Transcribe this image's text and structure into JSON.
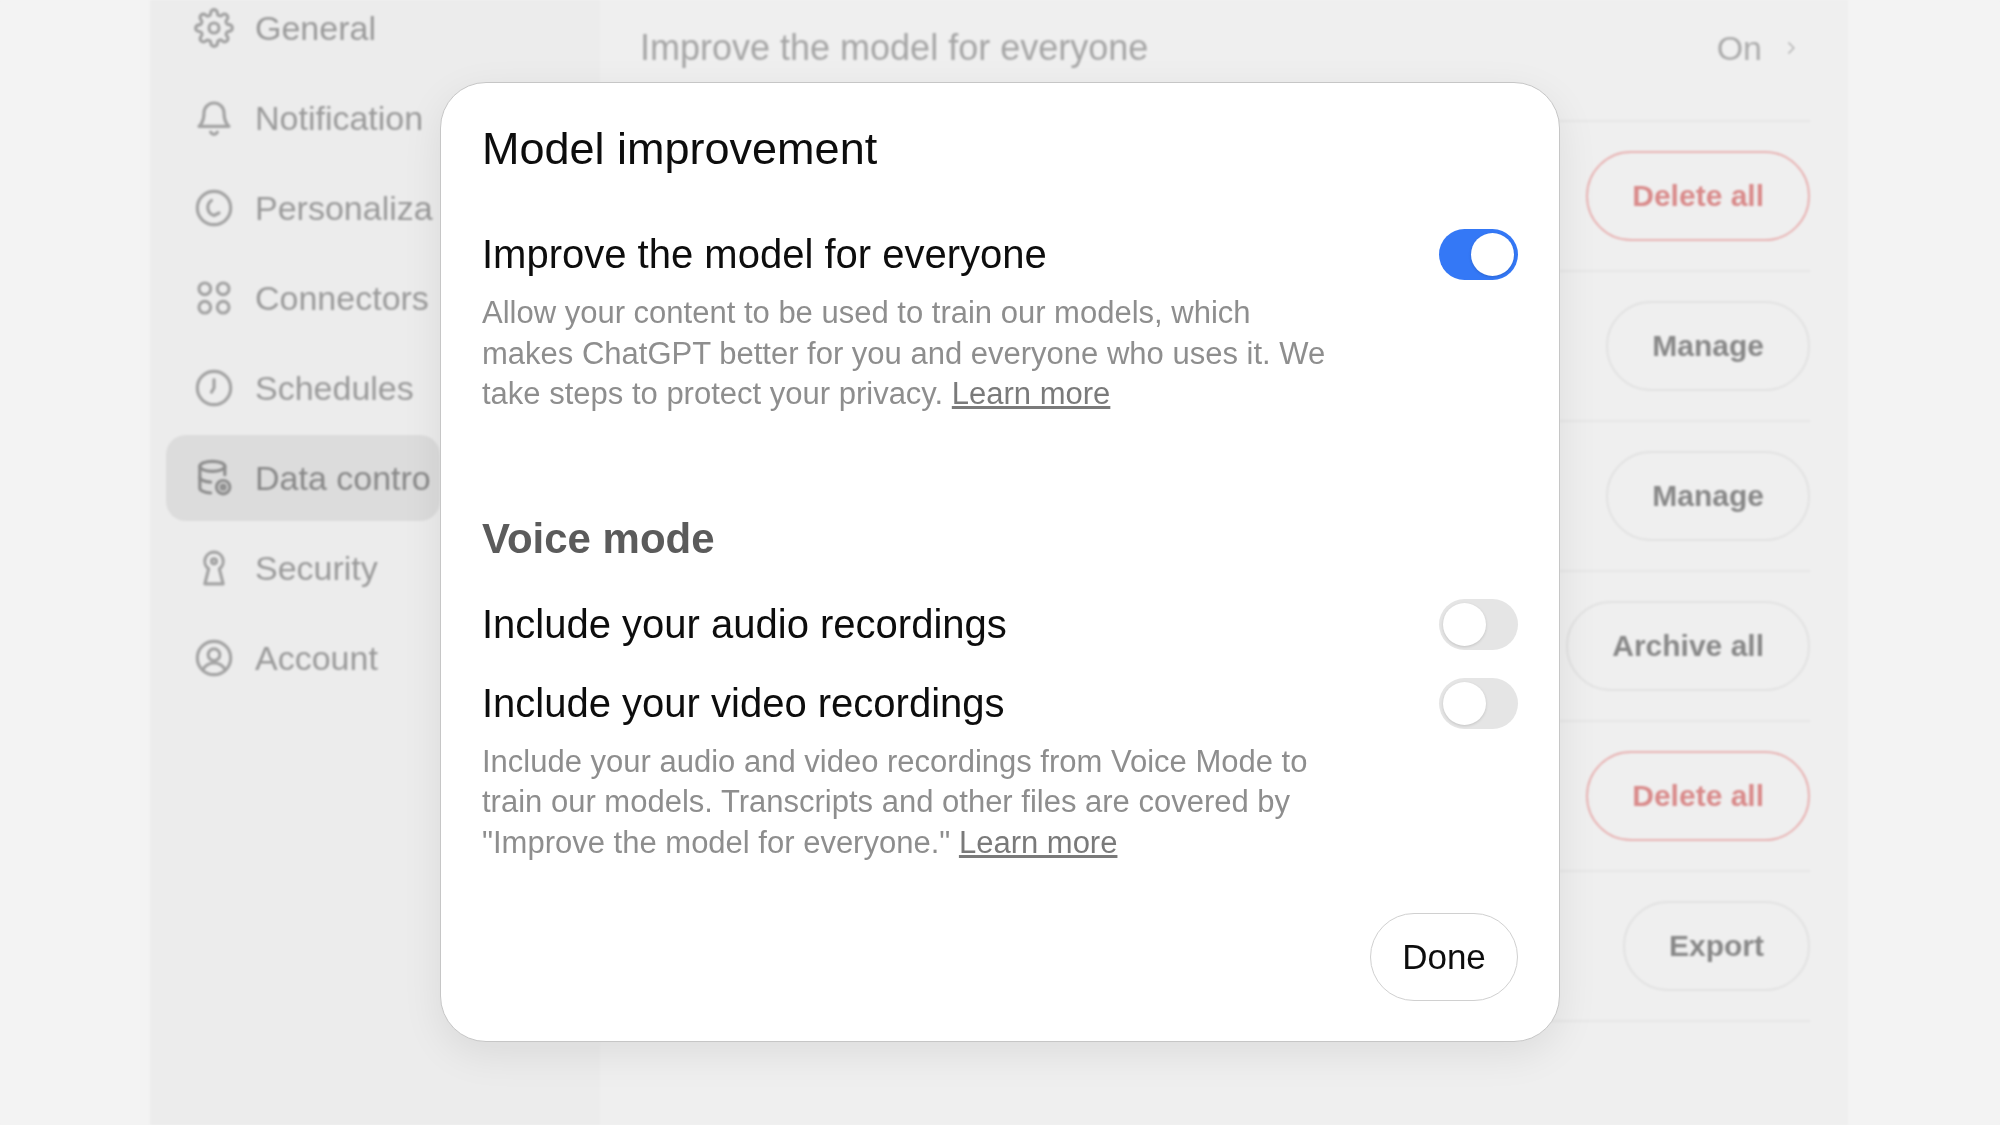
{
  "sidebar": {
    "items": [
      {
        "label": "General",
        "selected": false
      },
      {
        "label": "Notification",
        "selected": false
      },
      {
        "label": "Personaliza",
        "selected": false
      },
      {
        "label": "Connectors",
        "selected": false
      },
      {
        "label": "Schedules",
        "selected": false
      },
      {
        "label": "Data contro",
        "selected": true
      },
      {
        "label": "Security",
        "selected": false
      },
      {
        "label": "Account",
        "selected": false
      }
    ]
  },
  "settings": {
    "rows": [
      {
        "kind": "value",
        "label": "Improve the model for everyone",
        "value": "On"
      },
      {
        "kind": "danger",
        "button": "Delete all"
      },
      {
        "kind": "plain",
        "button": "Manage"
      },
      {
        "kind": "plain",
        "button": "Manage"
      },
      {
        "kind": "plain",
        "button": "Archive all"
      },
      {
        "kind": "danger",
        "button": "Delete all"
      },
      {
        "kind": "plain",
        "button": "Export"
      }
    ]
  },
  "dialog": {
    "title": "Model improvement",
    "groups": [
      {
        "toggles": [
          {
            "label": "Improve the model for everyone",
            "on": true
          }
        ],
        "description": "Allow your content to be used to train our models, which makes ChatGPT better for you and everyone who uses it. We take steps to protect your privacy.",
        "link": "Learn more"
      },
      {
        "heading": "Voice mode",
        "toggles": [
          {
            "label": "Include your audio recordings",
            "on": false
          },
          {
            "label": "Include your video recordings",
            "on": false
          }
        ],
        "description": "Include your audio and video recordings from Voice Mode to train our models. Transcripts and other files are covered by \"Improve the model for everyone.\"",
        "link": "Learn more"
      }
    ],
    "done_button": "Done"
  }
}
